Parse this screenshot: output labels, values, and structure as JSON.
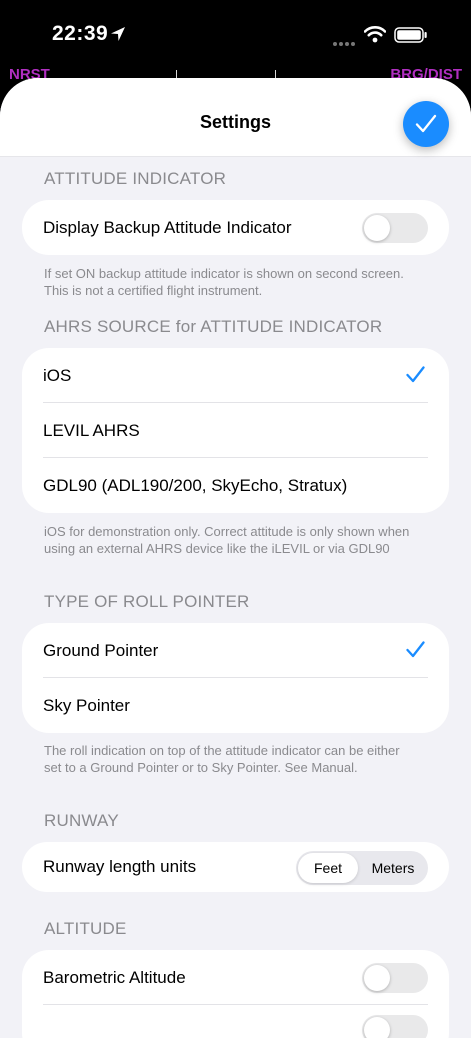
{
  "status_bar": {
    "time": "22:39"
  },
  "background_app": {
    "left_label": "NRST",
    "right_label": "BRG/DIST"
  },
  "nav": {
    "title": "Settings"
  },
  "colors": {
    "accent": "#1a8cff",
    "sheet_bg": "#f2f2f7",
    "secondary_text": "#8a8a8e",
    "bg_app_label": "#b12fc1"
  },
  "attitude": {
    "header": "ATTITUDE INDICATOR",
    "backup_label": "Display Backup Attitude Indicator",
    "backup_on": false,
    "footer": "If set ON backup attitude indicator is shown on second screen. This is not a certified flight instrument."
  },
  "ahrs": {
    "header": "AHRS SOURCE for ATTITUDE INDICATOR",
    "options": [
      "iOS",
      "LEVIL AHRS",
      "GDL90 (ADL190/200, SkyEcho, Stratux)"
    ],
    "selected": "iOS",
    "footer": "iOS for demonstration only. Correct attitude is only shown when using an external AHRS device like the iLEVIL or via GDL90"
  },
  "roll": {
    "header": "TYPE OF ROLL POINTER",
    "options": [
      "Ground Pointer",
      "Sky Pointer"
    ],
    "selected": "Ground Pointer",
    "footer": "The roll indication on top of the attitude indicator can be either set to a Ground Pointer or to Sky Pointer. See Manual."
  },
  "runway": {
    "header": "RUNWAY",
    "length_label": "Runway length units",
    "unit_options": [
      "Feet",
      "Meters"
    ],
    "selected_unit": "Feet"
  },
  "altitude": {
    "header": "ALTITUDE",
    "baro_label": "Barometric Altitude",
    "baro_on": false
  }
}
